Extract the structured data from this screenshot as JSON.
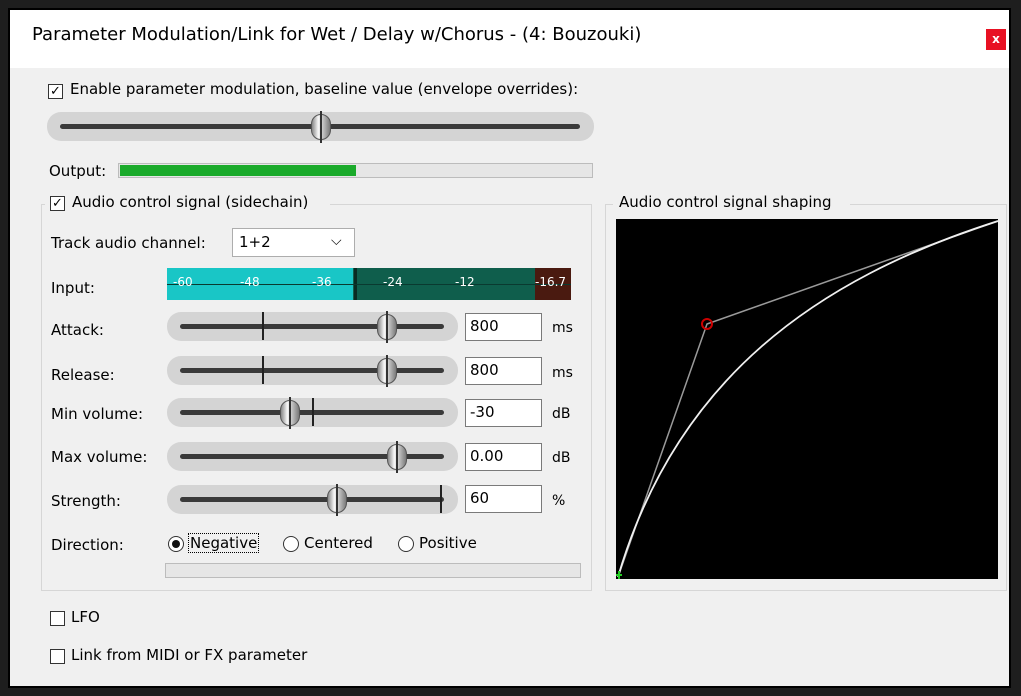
{
  "window": {
    "title": "Parameter Modulation/Link for Wet / Delay w/Chorus - (4: Bouzouki)",
    "close_label": "x"
  },
  "enable": {
    "label": "Enable parameter modulation, baseline value (envelope overrides):",
    "checked": true,
    "baseline_fraction": 0.51
  },
  "output": {
    "label": "Output:",
    "level_fraction": 0.5
  },
  "audio": {
    "label": "Audio control signal (sidechain)",
    "checked": true,
    "channel_label": "Track audio channel:",
    "channel_value": "1+2",
    "input_label": "Input:",
    "meter_ticks": [
      "-60",
      "-48",
      "-36",
      "-24",
      "-12"
    ],
    "meter_peak": "-16.7",
    "rows": [
      {
        "label": "Attack:",
        "value": "800",
        "unit": "ms"
      },
      {
        "label": "Release:",
        "value": "800",
        "unit": "ms"
      },
      {
        "label": "Min volume:",
        "value": "-30",
        "unit": "dB"
      },
      {
        "label": "Max volume:",
        "value": "0.00",
        "unit": "dB"
      },
      {
        "label": "Strength:",
        "value": "60",
        "unit": "%"
      }
    ],
    "direction_label": "Direction:",
    "direction_options": [
      "Negative",
      "Centered",
      "Positive"
    ],
    "direction_selected": "Negative"
  },
  "shaping": {
    "label": "Audio control signal shaping"
  },
  "lfo": {
    "label": "LFO",
    "checked": false
  },
  "link": {
    "label": "Link from MIDI or FX parameter",
    "checked": false
  },
  "colors": {
    "output_bar": "#1aaa2a",
    "meter_cyan": "#19c6c6",
    "meter_teal": "#0f5e4c",
    "meter_peak": "#4a1a10",
    "curve_bg": "#000000",
    "control_point": "#cc0000"
  }
}
